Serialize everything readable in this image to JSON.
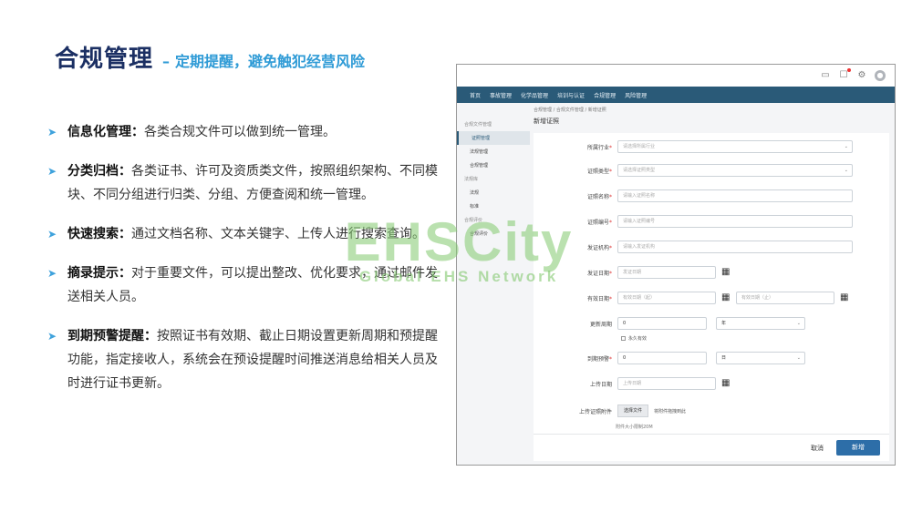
{
  "slide": {
    "title_main": "合规管理",
    "title_sep": "–",
    "title_sub": "定期提醒，避免触犯经营风险"
  },
  "bullets": [
    {
      "head": "信息化管理：",
      "body": "各类合规文件可以做到统一管理。"
    },
    {
      "head": "分类归档：",
      "body": "各类证书、许可及资质类文件，按照组织架构、不同模块、不同分组进行归类、分组、方便查阅和统一管理。"
    },
    {
      "head": "快速搜索：",
      "body": "通过文档名称、文本关键字、上传人进行搜索查询。"
    },
    {
      "head": "摘录提示：",
      "body": "对于重要文件，可以提出整改、优化要求，通过邮件发送相关人员。"
    },
    {
      "head": "到期预警提醒：",
      "body": "按照证书有效期、截止日期设置更新周期和预提醒功能，指定接收人，系统会在预设提醒时间推送消息给相关人员及时进行证书更新。"
    }
  ],
  "app": {
    "topbar_icons": [
      "inbox-icon",
      "notification-icon",
      "settings-icon",
      "user-avatar-icon"
    ],
    "nav": [
      "首页",
      "事故管理",
      "化学品管理",
      "培训与认证",
      "合规管理",
      "风险管理"
    ],
    "sidebar": {
      "group1": "合规文件管理",
      "items1": [
        "证照管理",
        "法规管理",
        "合规管理"
      ],
      "group2": "法规库",
      "items2": [
        "法规",
        "标准"
      ],
      "group3": "合规评价",
      "items3": [
        "合规评价"
      ]
    },
    "breadcrumb": "合规管理 / 合规文件管理 / 新增证照",
    "page_title": "新增证照",
    "form": {
      "industry": {
        "label": "所属行业",
        "placeholder": "请选择所属行业"
      },
      "cert_type": {
        "label": "证照类型",
        "placeholder": "请选择证照类型"
      },
      "cert_name": {
        "label": "证照名称",
        "placeholder": "请输入证照名称"
      },
      "cert_no": {
        "label": "证照编号",
        "placeholder": "请输入证照编号"
      },
      "issuer": {
        "label": "发证机构",
        "placeholder": "请输入发证机构"
      },
      "issue_date": {
        "label": "发证日期",
        "placeholder": "发证日期"
      },
      "valid_period": {
        "label": "有效日期",
        "start_placeholder": "有效日期（起）",
        "end_placeholder": "有效日期（止）"
      },
      "renew_cycle": {
        "label": "更新周期",
        "value": "0",
        "unit": "年"
      },
      "permanent": "永久有效",
      "remind_ahead": {
        "label": "到期预警",
        "value": "0",
        "unit": "日"
      },
      "upload_date": {
        "label": "上传日期",
        "placeholder": "上传日期"
      },
      "attachment": {
        "label": "上传证照附件",
        "button": "选择文件",
        "hint": "将附件拖拽到此"
      },
      "note": "附件大小限制20M"
    },
    "cancel": "取消",
    "submit": "新增"
  },
  "watermark": {
    "big": "EHSCity",
    "small": "Global EHS Network"
  }
}
